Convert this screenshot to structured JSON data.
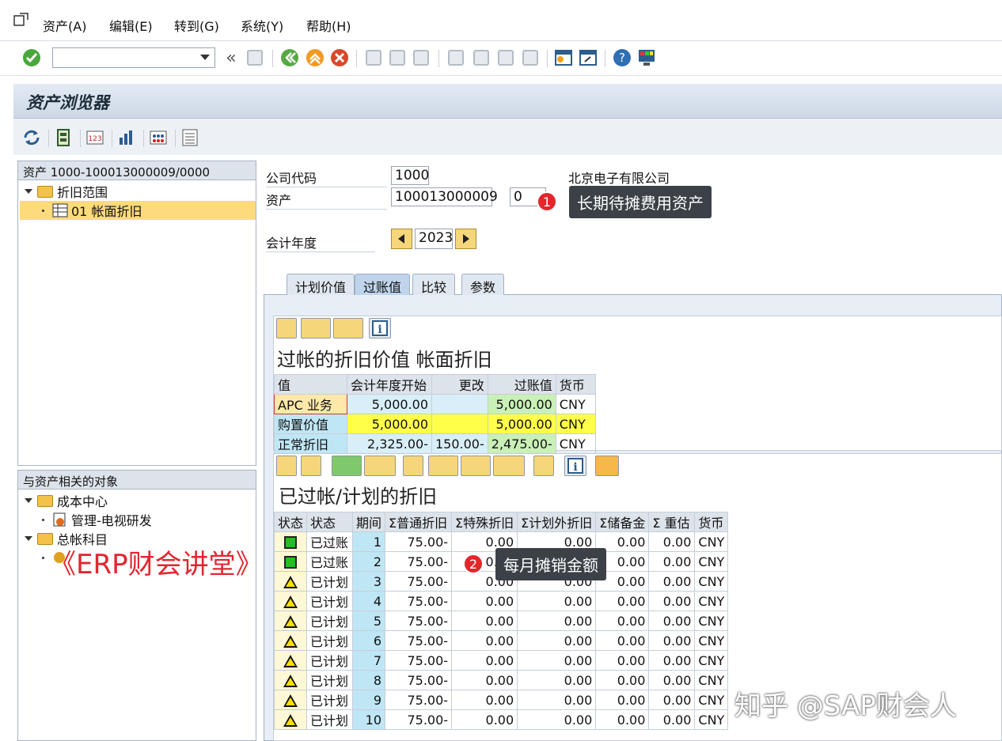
{
  "menu": [
    "资产(A)",
    "编辑(E)",
    "转到(G)",
    "系统(Y)",
    "帮助(H)"
  ],
  "toolbar": {
    "back_glyph": "«"
  },
  "title": "资产浏览器",
  "left_tree": {
    "header": "资产 1000-100013000009/0000",
    "folder": "折旧范围",
    "item": "01  帐面折旧"
  },
  "related": {
    "header": "与资产相关的对象",
    "cost_center_folder": "成本中心",
    "cost_center_item": "管理-电视研发",
    "gl_folder": "总帐科目"
  },
  "form": {
    "company_code_label": "公司代码",
    "company_code": "1000",
    "company_name": "北京电子有限公司",
    "asset_label": "资产",
    "asset_no": "100013000009",
    "asset_sub": "0",
    "fiscal_year_label": "会计年度",
    "fiscal_year": "2023"
  },
  "tabs": [
    "计划价值",
    "过账值",
    "比较",
    "参数"
  ],
  "grid1": {
    "title": "过帐的折旧价值 帐面折旧",
    "headers": [
      "值",
      "会计年度开始",
      "更改",
      "过账值",
      "货币"
    ],
    "rows": [
      {
        "label": "APC 业务",
        "start": "5,000.00",
        "change": "",
        "posted": "5,000.00",
        "cur": "CNY"
      },
      {
        "label": "购置价值",
        "start": "5,000.00",
        "change": "",
        "posted": "5,000.00",
        "cur": "CNY"
      },
      {
        "label": "正常折旧",
        "start": "2,325.00-",
        "change": "150.00-",
        "posted": "2,475.00-",
        "cur": "CNY"
      }
    ]
  },
  "grid2": {
    "title": "已过帐/计划的折旧",
    "headers": [
      "状态",
      "状态",
      "期间",
      "Σ普通折旧",
      "Σ特殊折旧",
      "Σ计划外折旧",
      "Σ储备金",
      "Σ  重估",
      "货币"
    ],
    "rows": [
      {
        "icon": "green",
        "status": "已过账",
        "period": "1",
        "ord": "75.00-",
        "spec": "0.00",
        "unpl": "0.00",
        "res": "0.00",
        "reval": "0.00",
        "cur": "CNY"
      },
      {
        "icon": "green",
        "status": "已过账",
        "period": "2",
        "ord": "75.00-",
        "spec": "0.00",
        "unpl": "0.00",
        "res": "0.00",
        "reval": "0.00",
        "cur": "CNY"
      },
      {
        "icon": "warn",
        "status": "已计划",
        "period": "3",
        "ord": "75.00-",
        "spec": "0.00",
        "unpl": "0.00",
        "res": "0.00",
        "reval": "0.00",
        "cur": "CNY"
      },
      {
        "icon": "warn",
        "status": "已计划",
        "period": "4",
        "ord": "75.00-",
        "spec": "0.00",
        "unpl": "0.00",
        "res": "0.00",
        "reval": "0.00",
        "cur": "CNY"
      },
      {
        "icon": "warn",
        "status": "已计划",
        "period": "5",
        "ord": "75.00-",
        "spec": "0.00",
        "unpl": "0.00",
        "res": "0.00",
        "reval": "0.00",
        "cur": "CNY"
      },
      {
        "icon": "warn",
        "status": "已计划",
        "period": "6",
        "ord": "75.00-",
        "spec": "0.00",
        "unpl": "0.00",
        "res": "0.00",
        "reval": "0.00",
        "cur": "CNY"
      },
      {
        "icon": "warn",
        "status": "已计划",
        "period": "7",
        "ord": "75.00-",
        "spec": "0.00",
        "unpl": "0.00",
        "res": "0.00",
        "reval": "0.00",
        "cur": "CNY"
      },
      {
        "icon": "warn",
        "status": "已计划",
        "period": "8",
        "ord": "75.00-",
        "spec": "0.00",
        "unpl": "0.00",
        "res": "0.00",
        "reval": "0.00",
        "cur": "CNY"
      },
      {
        "icon": "warn",
        "status": "已计划",
        "period": "9",
        "ord": "75.00-",
        "spec": "0.00",
        "unpl": "0.00",
        "res": "0.00",
        "reval": "0.00",
        "cur": "CNY"
      },
      {
        "icon": "warn",
        "status": "已计划",
        "period": "10",
        "ord": "75.00-",
        "spec": "0.00",
        "unpl": "0.00",
        "res": "0.00",
        "reval": "0.00",
        "cur": "CNY"
      }
    ]
  },
  "callouts": [
    {
      "num": "1",
      "text": "长期待摊费用资产"
    },
    {
      "num": "2",
      "text": "每月摊销金额"
    }
  ],
  "watermarks": [
    "《ERP财会讲堂》",
    "知乎 @SAP财会人"
  ]
}
